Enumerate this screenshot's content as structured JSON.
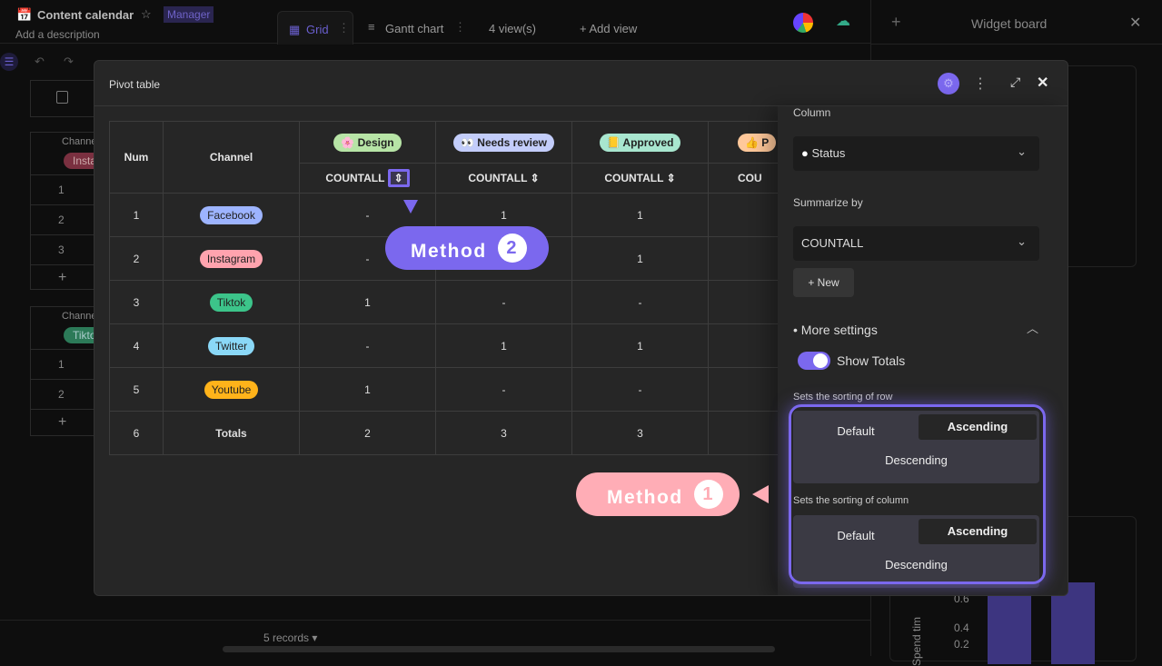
{
  "app": {
    "title": "Content calendar",
    "role_badge": "Manager",
    "description": "Add a description",
    "views": [
      {
        "label": "Grid"
      },
      {
        "label": "Gantt chart"
      }
    ],
    "views_count": "4 view(s)",
    "add_view": "+ Add view"
  },
  "widget_board": {
    "title": "Widget board",
    "axis_label": "Spend tim",
    "ticks": [
      "0.6",
      "0.4",
      "0.2"
    ]
  },
  "background": {
    "groups": [
      {
        "field": "Channel",
        "value": "Insta",
        "rows": [
          "1",
          "2",
          "3"
        ]
      },
      {
        "field": "Channel",
        "value": "Tikto",
        "rows": [
          "1",
          "2"
        ]
      }
    ],
    "records": "5 records ▾"
  },
  "modal": {
    "title": "Pivot table",
    "table": {
      "headers": {
        "num": "Num",
        "channel": "Channel"
      },
      "columns": [
        {
          "label": "🌸 Design",
          "color": "#b7e4a6",
          "agg": "COUNTALL"
        },
        {
          "label": "👀 Needs review",
          "color": "#c3cdfa",
          "agg": "COUNTALL"
        },
        {
          "label": "📒 Approved",
          "color": "#a8e6cf",
          "agg": "COUNTALL"
        },
        {
          "label": "👍 P",
          "color": "#ffc89a",
          "agg": "COU"
        }
      ],
      "rows": [
        {
          "num": "1",
          "channel": "Facebook",
          "color": "#9db4ff",
          "values": [
            "-",
            "1",
            "1"
          ]
        },
        {
          "num": "2",
          "channel": "Instagram",
          "color": "#ffa3ae",
          "values": [
            "-",
            "",
            "1"
          ]
        },
        {
          "num": "3",
          "channel": "Tiktok",
          "color": "#3cc48a",
          "values": [
            "1",
            "-",
            "-"
          ]
        },
        {
          "num": "4",
          "channel": "Twitter",
          "color": "#8ad8f7",
          "values": [
            "-",
            "1",
            "1"
          ]
        },
        {
          "num": "5",
          "channel": "Youtube",
          "color": "#ffb31a",
          "values": [
            "1",
            "-",
            "-"
          ]
        }
      ],
      "totals": {
        "num": "6",
        "label": "Totals",
        "values": [
          "2",
          "3",
          "3"
        ]
      }
    },
    "settings": {
      "column_label": "Column",
      "column_value": "Status",
      "summarize_label": "Summarize by",
      "summarize_value": "COUNTALL",
      "new_button": "+ New",
      "more_settings": "More settings",
      "show_totals": "Show Totals",
      "show_totals_on": true,
      "row_sort_label": "Sets the sorting of row",
      "col_sort_label": "Sets the sorting of column",
      "sort_options": [
        "Default",
        "Ascending",
        "Descending"
      ],
      "row_sort_selected": "Ascending",
      "col_sort_selected": "Ascending"
    }
  },
  "callouts": {
    "method1": "Method",
    "method1_num": "1",
    "method2": "Method",
    "method2_num": "2"
  },
  "colors": {
    "accent": "#7b68ee",
    "callout1": "#ffadb6",
    "callout2": "#7b68ee"
  }
}
